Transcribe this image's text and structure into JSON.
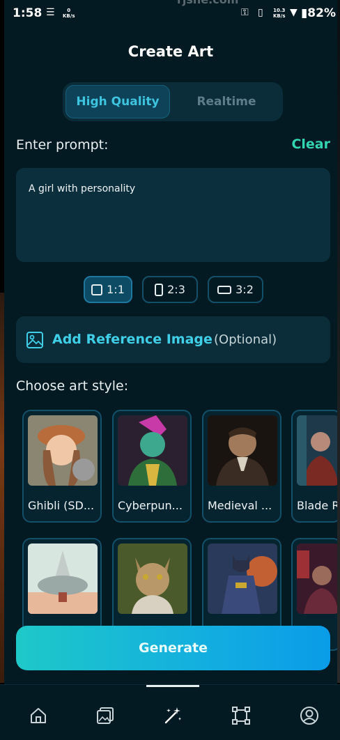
{
  "status": {
    "time": "1:58",
    "net_speed_left_value": "0",
    "net_speed_left_unit": "KB/s",
    "net_speed_right_value": "10.3",
    "net_speed_right_unit": "KB/s",
    "battery": "82%",
    "watermark": "rjsne.com"
  },
  "header": {
    "title": "Create Art"
  },
  "mode": {
    "high_quality": "High Quality",
    "realtime": "Realtime",
    "selected": "High Quality"
  },
  "prompt": {
    "label": "Enter prompt:",
    "clear": "Clear",
    "value": "A girl with personality"
  },
  "ratios": {
    "r11": "1:1",
    "r23": "2:3",
    "r32": "3:2",
    "selected": "1:1"
  },
  "reference": {
    "label": "Add Reference Image",
    "optional": "(Optional)"
  },
  "styles": {
    "label": "Choose art style:",
    "items": [
      {
        "label": "Ghibli (SD..."
      },
      {
        "label": "Cyberpun..."
      },
      {
        "label": "Medieval ..."
      },
      {
        "label": "Blade R"
      }
    ]
  },
  "generate": {
    "label": "Generate"
  },
  "nav": {
    "items": [
      "home-icon",
      "gallery-icon",
      "magic-wand-icon",
      "frame-icon",
      "profile-icon"
    ],
    "active": "magic-wand-icon"
  },
  "colors": {
    "accent_teal": "#33d4b0",
    "accent_cyan": "#3fc4e0",
    "background": "#041a22"
  }
}
